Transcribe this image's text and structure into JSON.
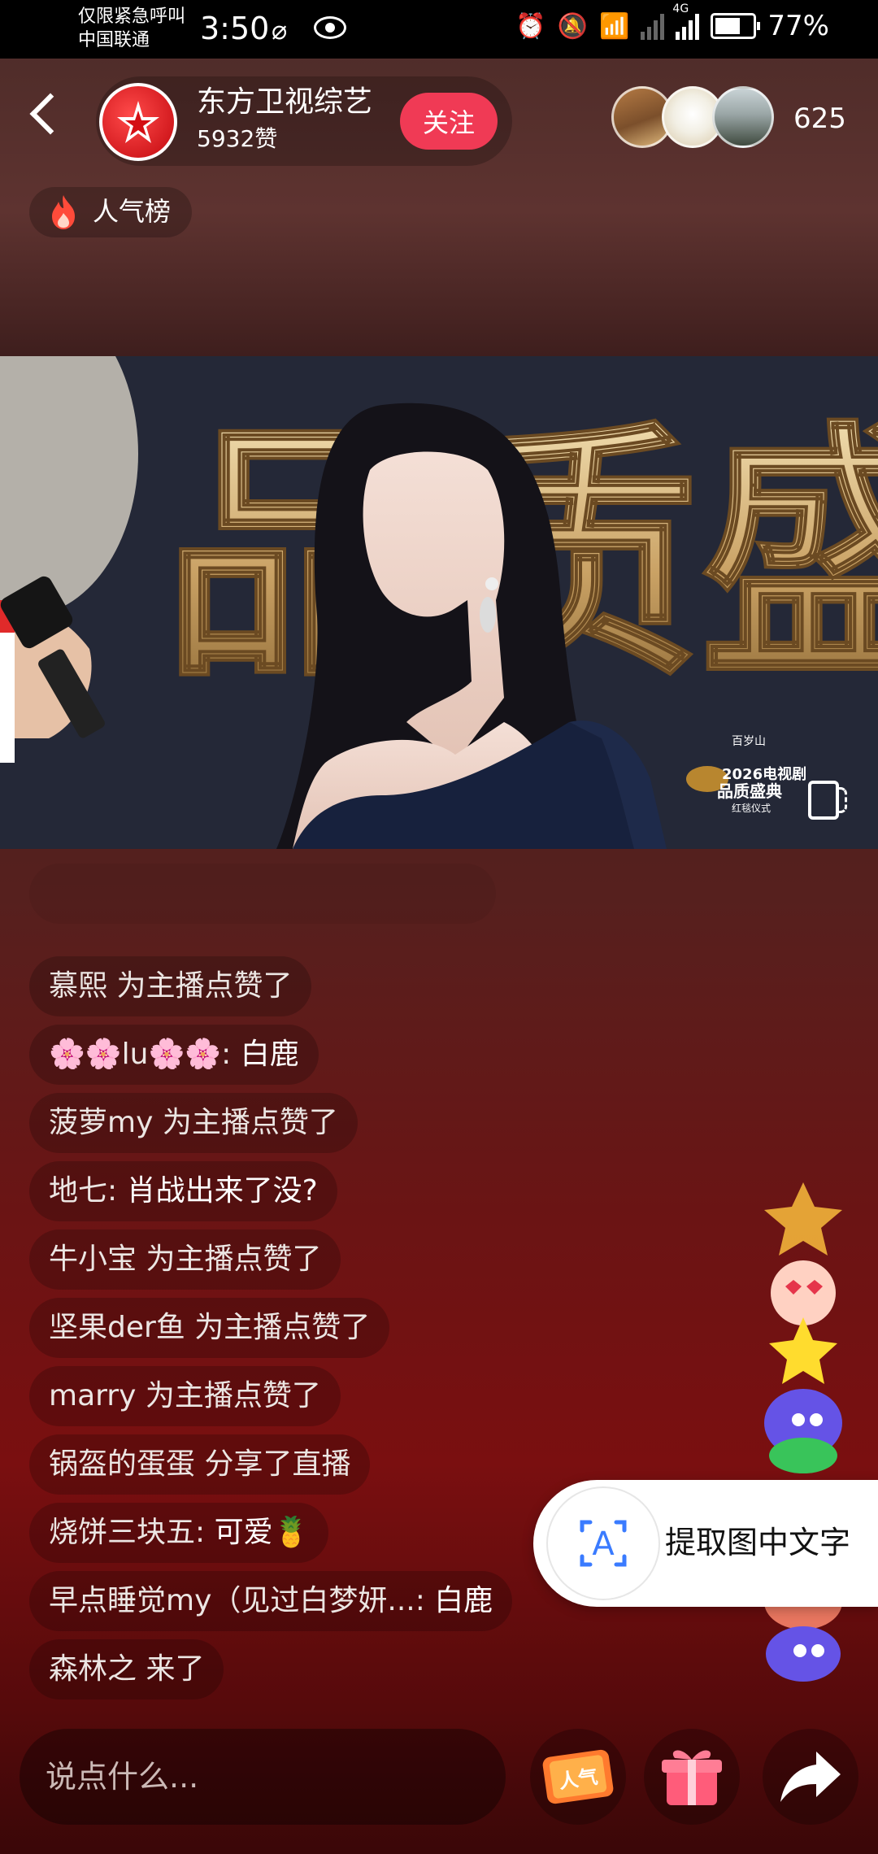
{
  "status_bar": {
    "carrier_line1": "仅限紧急呼叫",
    "carrier_line2": "中国联通",
    "time": "3:50",
    "network": "4G",
    "battery": "77%",
    "icons": [
      "speed-icon",
      "eye-icon",
      "alarm-icon",
      "mute-icon",
      "wifi-icon",
      "signal-icon",
      "battery-icon"
    ]
  },
  "header": {
    "host_name": "东方卫视综艺",
    "likes": "5932赞",
    "follow_label": "关注",
    "viewer_count": "625"
  },
  "rank_badge": {
    "label": "人气榜"
  },
  "video": {
    "backdrop_text": "品质盛",
    "watermark_line1": "百岁山",
    "watermark_line2": "2026电视剧",
    "watermark_line3": "品质盛典",
    "watermark_line4": "红毯仪式"
  },
  "comments": [
    {
      "user": "慕熙",
      "text": " 为主播点赞了",
      "system": true
    },
    {
      "user": "🌸🌸lu🌸🌸",
      "text": "白鹿",
      "system": false
    },
    {
      "user": "菠萝my",
      "text": " 为主播点赞了",
      "system": true
    },
    {
      "user": "地七",
      "text": "肖战出来了没?",
      "system": false
    },
    {
      "user": "牛小宝",
      "text": " 为主播点赞了",
      "system": true
    },
    {
      "user": "坚果der鱼",
      "text": " 为主播点赞了",
      "system": true
    },
    {
      "user": "marry",
      "text": " 为主播点赞了",
      "system": true
    },
    {
      "user": "锅盔的蛋蛋",
      "text": " 分享了直播",
      "system": true
    },
    {
      "user": "烧饼三块五",
      "text": "可爱🍍",
      "system": false
    },
    {
      "user": "早点睡觉my（见过白梦妍...",
      "text": "白鹿",
      "system": false
    },
    {
      "user": "森林之",
      "text": " 来了",
      "system": true
    }
  ],
  "popup": {
    "label": "提取图中文字"
  },
  "bottom_bar": {
    "input_placeholder": "说点什么...",
    "popularity_label": "人气"
  },
  "colors": {
    "follow": "#f03a55",
    "accent": "#ff3b30"
  }
}
